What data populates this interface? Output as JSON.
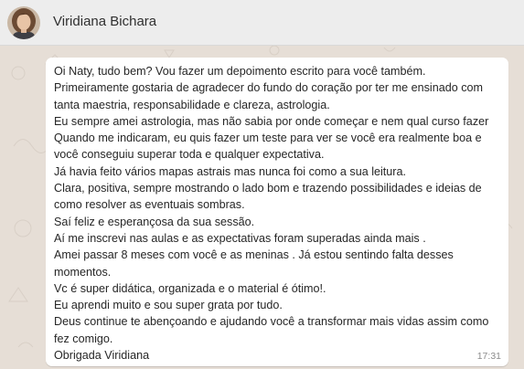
{
  "header": {
    "contact_name": "Viridiana Bichara",
    "avatar_icon": "profile-photo-avatar"
  },
  "message": {
    "lines": [
      "Oi Naty, tudo bem? Vou fazer um depoimento escrito para você também.",
      "Primeiramente gostaria de agradecer do fundo do coração por ter me ensinado com",
      "tanta maestria, responsabilidade e clareza, astrologia.",
      "Eu sempre amei astrologia, mas não sabia por onde começar e nem qual curso fazer",
      "Quando me indicaram, eu quis fazer um teste para ver se você era realmente boa e",
      "você conseguiu superar toda e qualquer expectativa.",
      "Já havia feito vários mapas astrais mas nunca foi como a sua leitura.",
      "Clara, positiva, sempre mostrando o lado bom e trazendo possibilidades e ideias de",
      "como resolver as eventuais sombras.",
      "Saí feliz e esperançosa da sua sessão.",
      "Aí me inscrevi nas aulas e as expectativas foram superadas ainda mais .",
      "Amei passar 8 meses com você e as meninas . Já estou sentindo falta desses",
      "momentos.",
      "Vc é super didática, organizada e o material é ótimo!.",
      "Eu aprendi muito e sou super grata por tudo.",
      "Deus continue te abençoando e ajudando você a transformar mais vidas assim como",
      "fez comigo.",
      "Obrigada Viridiana"
    ],
    "time": "17:31"
  },
  "colors": {
    "header_bg": "#ededed",
    "chat_bg": "#e6ded6",
    "bubble_bg": "#ffffff",
    "text": "#262626",
    "time": "#8c8c8c"
  }
}
